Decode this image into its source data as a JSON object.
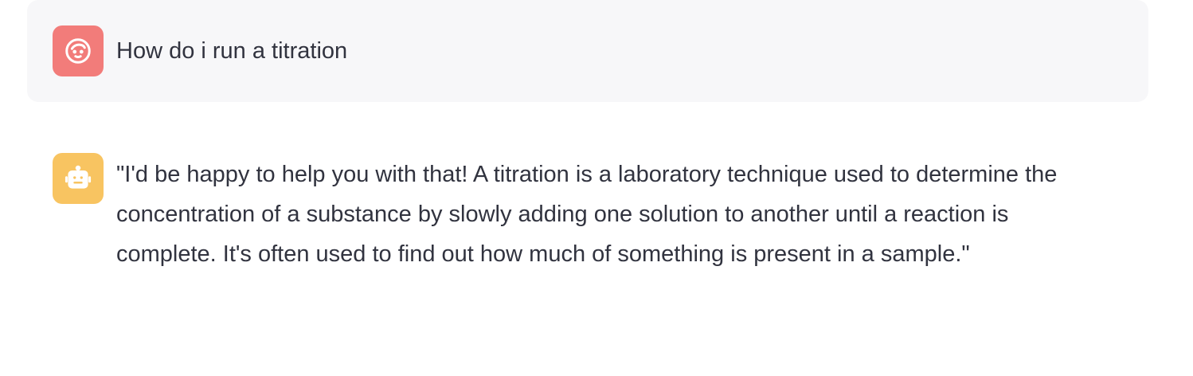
{
  "chat": {
    "messages": [
      {
        "role": "user",
        "avatar_icon": "user-face-icon",
        "avatar_color": "#f27c7a",
        "text": "How do i run a titration"
      },
      {
        "role": "assistant",
        "avatar_icon": "robot-icon",
        "avatar_color": "#f8c461",
        "text": "\"I'd be happy to help you with that! A titration is a laboratory technique used to determine the concentration of a substance by slowly adding one solution to another until a reaction is complete. It's often used to find out how much of something is present in a sample.\""
      }
    ]
  }
}
